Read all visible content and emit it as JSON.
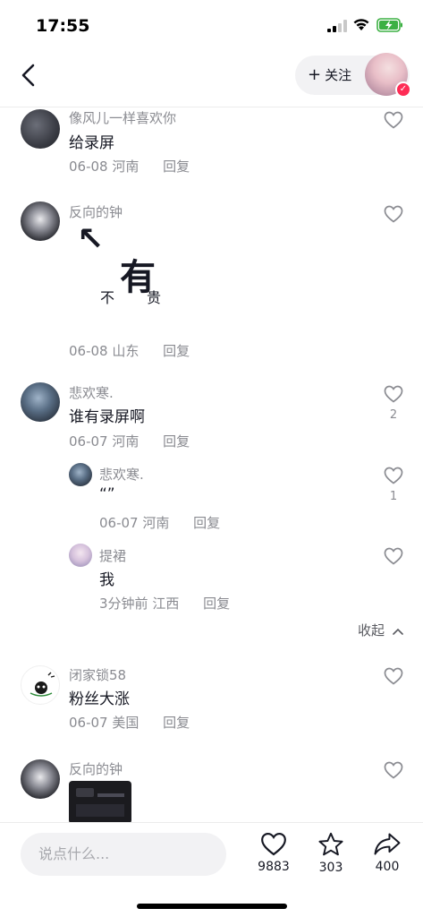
{
  "status_bar": {
    "time": "17:55"
  },
  "nav": {
    "follow_label": "关注",
    "follow_plus": "+"
  },
  "comments": [
    {
      "name": "像风儿一样喜欢你",
      "text": "给录屏",
      "date": "06-08",
      "location": "河南",
      "reply": "回复",
      "likes": ""
    },
    {
      "name": "反向的钟",
      "sticker_text": {
        "big": "有",
        "left": "不",
        "right": "贵",
        "arrow": "↖"
      },
      "date": "06-08",
      "location": "山东",
      "reply": "回复",
      "likes": ""
    },
    {
      "name": "悲欢寒.",
      "text": "谁有录屏啊",
      "date": "06-07",
      "location": "河南",
      "reply": "回复",
      "likes": "2"
    }
  ],
  "replies": [
    {
      "name": "悲欢寒.",
      "text": "“”",
      "date": "06-07",
      "location": "河南",
      "reply": "回复",
      "likes": "1"
    },
    {
      "name": "提裙",
      "text": "我",
      "date": "3分钟前",
      "location": "江西",
      "reply": "回复",
      "likes": ""
    }
  ],
  "collapse_label": "收起",
  "comments2": [
    {
      "name": "闭家锁58",
      "text": "粉丝大涨",
      "date": "06-07",
      "location": "美国",
      "reply": "回复",
      "likes": ""
    },
    {
      "name": "反向的钟",
      "likes": ""
    }
  ],
  "bottom": {
    "input_placeholder": "说点什么...",
    "like_count": "9883",
    "star_count": "303",
    "share_count": "400"
  }
}
